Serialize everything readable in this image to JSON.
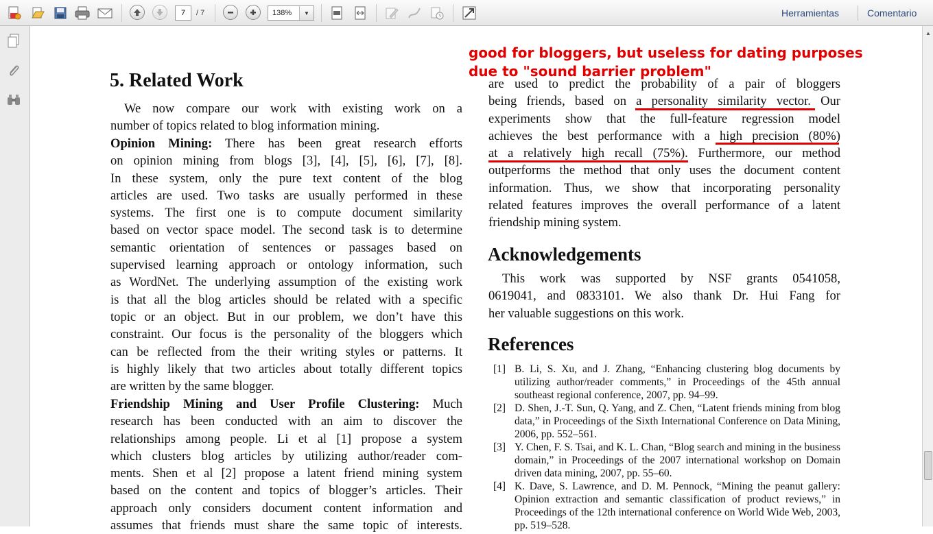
{
  "toolbar": {
    "page_current": "7",
    "page_total": "/ 7",
    "zoom": "138%",
    "tools_label": "Herramientas",
    "comment_label": "Comentario"
  },
  "annotation": {
    "line1": "good for bloggers, but useless for dating purposes",
    "line2": "due to \"sound barrier problem\""
  },
  "left_column": {
    "heading": "5.  Related Work",
    "intro_lines": [
      "We now compare our work with existing work on a",
      "number of topics related to blog information mining."
    ],
    "opinion_label": "Opinion Mining:",
    "opinion_lines": [
      " There has been great research efforts",
      "on opinion mining from blogs [3], [4], [5], [6], [7], [8].",
      "In these system, only the pure text content of the blog",
      "articles are used. Two tasks are usually performed in these",
      "systems. The first one is to compute document similarity",
      "based on vector space model. The second task is to determine",
      "semantic orientation of sentences or passages based on",
      "supervised learning approach or ontology information, such",
      "as WordNet. The underlying assumption of the existing work",
      "is that all the blog articles should be related with a specific",
      "topic or an object. But in our problem, we don’t have this",
      "constraint. Our focus is the personality of the bloggers which",
      "can be reflected from the their writing styles or patterns. It",
      "is highly likely that two articles about totally different topics",
      "are written by the same blogger."
    ],
    "friendship_label": "Friendship Mining and User Profile Clustering:",
    "friendship_first": " Much",
    "friendship_lines": [
      "research has been conducted with an aim to discover the",
      "relationships among people. Li et al [1] propose a system",
      "which clusters blog articles by utilizing author/reader com-",
      "ments. Shen et al [2] propose a latent friend mining system",
      "based on the content and topics of blogger’s articles. Their",
      "approach only considers document content information and",
      "assumes that friends must share the same topic of interests."
    ]
  },
  "right_column": {
    "lines": [
      "are used to predict the probability of a pair of bloggers",
      "being friends, based on a personality similarity vector. Our",
      "experiments show that the full-feature regression model",
      "achieves the best performance with a high precision (80%)",
      "at a relatively high recall (75%). Furthermore, our method",
      "outperforms the method that only uses the document content",
      "information. Thus, we show that incorporating personality",
      "related features improves the overall performance of a latent",
      "friendship mining system."
    ],
    "ack_heading": "Acknowledgements",
    "ack_lines": [
      "This work was supported by NSF grants 0541058,",
      "0619041, and 0833101. We also thank Dr. Hui Fang for",
      "her valuable suggestions on this work."
    ],
    "ref_heading": "References",
    "references": [
      {
        "num": "[1]",
        "text": "B. Li, S. Xu, and J. Zhang, “Enhancing clustering blog documents by utilizing author/reader comments,” in Proceedings of the 45th annual southeast regional conference, 2007, pp. 94–99."
      },
      {
        "num": "[2]",
        "text": "D. Shen, J.-T. Sun, Q. Yang, and Z. Chen, “Latent friends mining from blog data,” in Proceedings of the Sixth International Conference on Data Mining, 2006, pp. 552–561."
      },
      {
        "num": "[3]",
        "text": "Y. Chen, F. S. Tsai, and K. L. Chan, “Blog search and mining in the business domain,” in Proceedings of the 2007 international workshop on Domain driven data mining, 2007, pp. 55–60."
      },
      {
        "num": "[4]",
        "text": "K. Dave, S. Lawrence, and D. M. Pennock, “Mining the peanut gallery: Opinion extraction and semantic classification of product reviews,” in Proceedings of the 12th international conference on World Wide Web, 2003, pp. 519–528."
      }
    ]
  },
  "colors": {
    "annotation_red": "#e00000",
    "link_blue": "#2b4a7a"
  }
}
